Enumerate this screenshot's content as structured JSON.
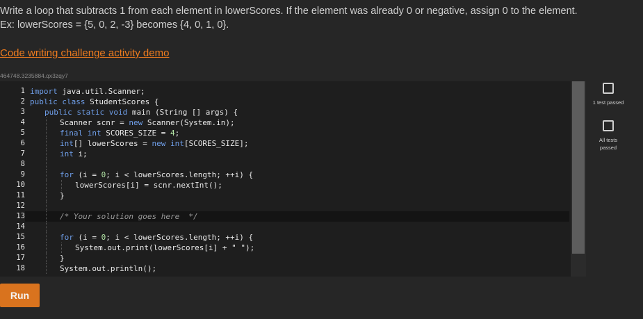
{
  "prompt": {
    "line1": "Write a loop that subtracts 1 from each element in lowerScores. If the element was already 0 or negative, assign 0 to the element.",
    "line2": "Ex: lowerScores = {5, 0, 2, -3} becomes {4, 0, 1, 0}."
  },
  "demo_link": "Code writing challenge activity demo",
  "activity_id": "464748.3235884.qx3zqy7",
  "editor": {
    "line_numbers": [
      "1",
      "2",
      "3",
      "4",
      "5",
      "6",
      "7",
      "8",
      "9",
      "10",
      "11",
      "12",
      "13",
      "14",
      "15",
      "16",
      "17",
      "18"
    ],
    "code": {
      "l1_kw": "import",
      "l1_rest": " java.util.Scanner;",
      "l2_kw": "public class",
      "l2_rest": " StudentScores {",
      "l3_kw": "public static void",
      "l3_rest": " main (String [] args) {",
      "l4_a": "Scanner scnr = ",
      "l4_kw": "new",
      "l4_b": " Scanner(System.in);",
      "l5_kw": "final int",
      "l5_a": " SCORES_SIZE = ",
      "l5_num": "4",
      "l5_b": ";",
      "l6_kw": "int",
      "l6_a": "[] lowerScores = ",
      "l6_kw2": "new int",
      "l6_b": "[SCORES_SIZE];",
      "l7_kw": "int",
      "l7_a": " i;",
      "l9_kw": "for",
      "l9_a": " (i = ",
      "l9_num": "0",
      "l9_b": "; i < lowerScores.length; ++i) {",
      "l10": "lowerScores[i] = scnr.nextInt();",
      "l11": "}",
      "l13_comment": "/* Your solution goes here  */",
      "l15_kw": "for",
      "l15_a": " (i = ",
      "l15_num": "0",
      "l15_b": "; i < lowerScores.length; ++i) {",
      "l16_a": "System.out.print(lowerScores[i] + ",
      "l16_str": "\" \"",
      "l16_b": ");",
      "l17": "}",
      "l18": "System.out.println();"
    }
  },
  "tests": {
    "first_label": "1 test passed",
    "all_label": "All tests passed"
  },
  "run_label": "Run"
}
